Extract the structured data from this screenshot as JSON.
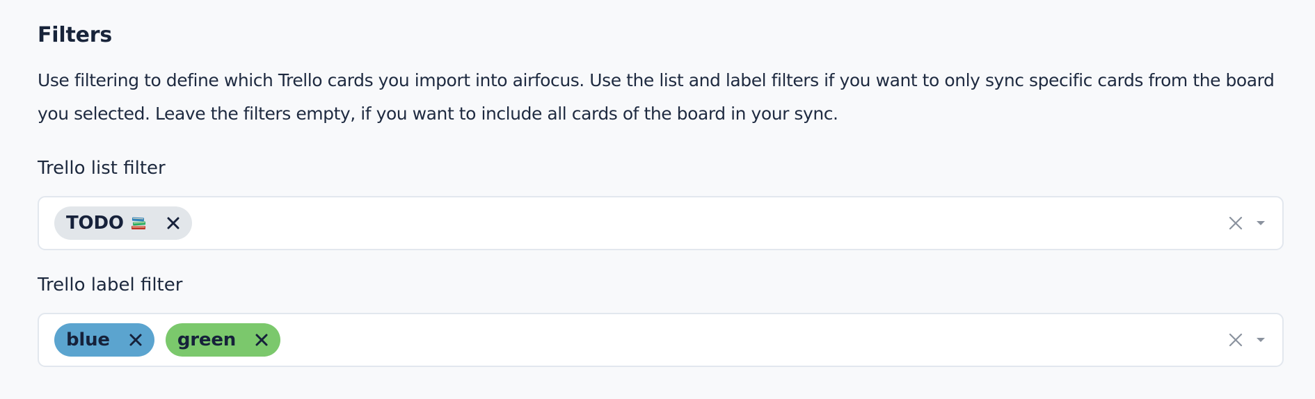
{
  "filters": {
    "title": "Filters",
    "description": "Use filtering to define which Trello cards you import into airfocus. Use the list and label filters if you want to only sync specific cards from the board you selected. Leave the filters empty, if you want to include all cards of the board in your sync.",
    "list_filter": {
      "label": "Trello list filter",
      "chips": [
        {
          "label": "TODO",
          "emoji_icon": "books-icon",
          "color": "#e2e6ea"
        }
      ]
    },
    "label_filter": {
      "label": "Trello label filter",
      "chips": [
        {
          "label": "blue",
          "color": "#5ba4cf"
        },
        {
          "label": "green",
          "color": "#7bc86c"
        }
      ]
    }
  },
  "icons": {
    "chip_remove": "close-icon",
    "clear": "clear-icon",
    "dropdown": "caret-down-icon"
  },
  "colors": {
    "page_background": "#f8f9fb",
    "text": "#18243a",
    "field_border": "#e2e7ee",
    "control_gray": "#8a929e"
  }
}
